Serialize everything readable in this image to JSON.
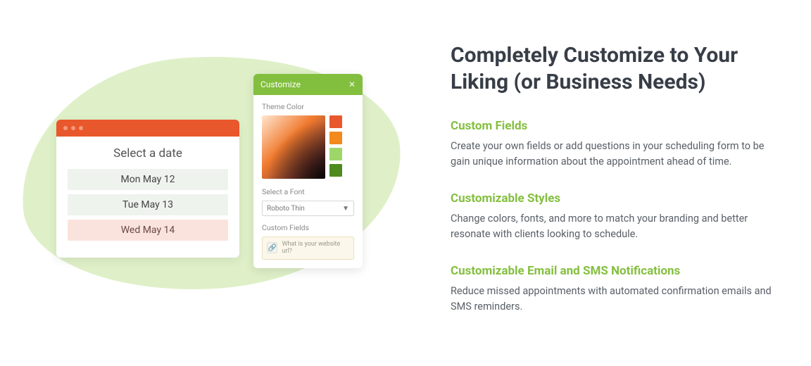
{
  "heading": "Completely Customize to Your Liking (or Business Needs)",
  "features": [
    {
      "title": "Custom Fields",
      "body": "Create your own fields or add questions in your scheduling form to be gain unique information about the appointment ahead of time."
    },
    {
      "title": "Customizable Styles",
      "body": "Change colors, fonts, and more to match your branding and better resonate with clients looking to schedule."
    },
    {
      "title": "Customizable Email and SMS Notifications",
      "body": "Reduce missed appointments with automated confirmation emails and SMS reminders."
    }
  ],
  "date_card": {
    "title": "Select a date",
    "items": [
      "Mon May 12",
      "Tue May 13",
      "Wed May 14"
    ],
    "selected_index": 2
  },
  "customize_panel": {
    "header": "Customize",
    "theme_label": "Theme Color",
    "swatches": [
      "#e8582c",
      "#f28a1e",
      "#9ed66a",
      "#4f8a1f"
    ],
    "font_label": "Select a Font",
    "font_value": "Roboto Thin",
    "custom_fields_label": "Custom Fields",
    "custom_field_question": "What is your website url?"
  }
}
